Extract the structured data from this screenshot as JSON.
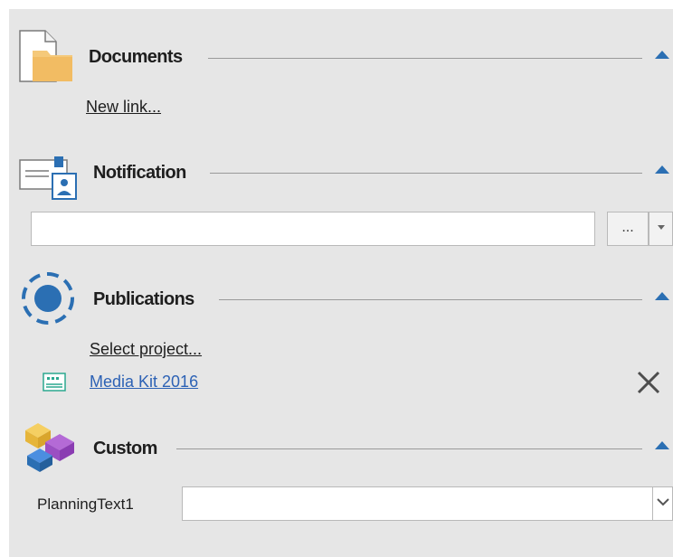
{
  "sections": {
    "documents": {
      "title": "Documents",
      "new_link": "New link..."
    },
    "notification": {
      "title": "Notification",
      "value": "",
      "browse_label": "..."
    },
    "publications": {
      "title": "Publications",
      "select_project": "Select project...",
      "item": "Media Kit 2016"
    },
    "custom": {
      "title": "Custom",
      "field_label": "PlanningText1",
      "field_value": ""
    }
  },
  "colors": {
    "accent": "#2b6fb3",
    "link": "#2d62b5",
    "panel_bg": "#e6e6e6"
  }
}
